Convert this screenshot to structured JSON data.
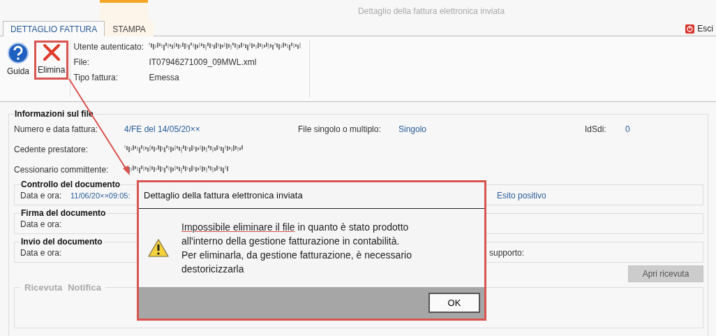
{
  "window": {
    "title": "Dettaglio della fattura elettronica inviata",
    "exit_label": "Esci"
  },
  "tabs": [
    {
      "label": "DETTAGLIO FATTURA",
      "selected": true
    },
    {
      "label": "STAMPA",
      "selected": false,
      "contextual": true
    }
  ],
  "ribbon": {
    "buttons": [
      {
        "label": "Guida",
        "kind": "help",
        "highlighted": false
      },
      {
        "label": "Elimina",
        "kind": "delete",
        "highlighted": true
      }
    ],
    "info": [
      {
        "label": "Utente autenticato:",
        "redacted": true
      },
      {
        "label": "File:",
        "value": "IT07946271009_09MWL.xml"
      },
      {
        "label": "Tipo fattura:",
        "value": "Emessa"
      }
    ]
  },
  "file_info": {
    "title": "Informazioni sul file",
    "rows": [
      [
        {
          "label": "Numero e data fattura:",
          "value": "4/FE del 14/05/20××"
        },
        {
          "label": "File singolo o multiplo:",
          "value": "Singolo"
        },
        {
          "label": "IdSdi:",
          "value": "0"
        }
      ],
      [
        {
          "label": "Cedente prestatore:",
          "redacted": true
        }
      ],
      [
        {
          "label": "Cessionario committente:",
          "redacted": true
        }
      ]
    ],
    "sections": [
      {
        "title": "Controllo del documento",
        "label": "Data e ora:",
        "value": "11/06/20××09:05:",
        "right_value": "Esito positivo"
      },
      {
        "title": "Firma del documento",
        "label": "Data e ora:"
      },
      {
        "title": "Invio del documento",
        "label": "Data e ora:",
        "right_label": "supporto:"
      }
    ],
    "open_button": "Apri ricevuta",
    "receipt_tabs": [
      {
        "label": "Ricevuta",
        "disabled": true
      },
      {
        "label": "Notifica",
        "disabled": true
      }
    ]
  },
  "dialog": {
    "title": "Dettaglio della fattura elettronica inviata",
    "highlight": "Impossibile eliminare il file",
    "lines": [
      "in quanto è stato prodotto",
      "all'interno della gestione fatturazione in contabilità.",
      "Per eliminarla, da gestione fatturazione, è necessario",
      "destoricizzarla"
    ],
    "button": "OK"
  }
}
